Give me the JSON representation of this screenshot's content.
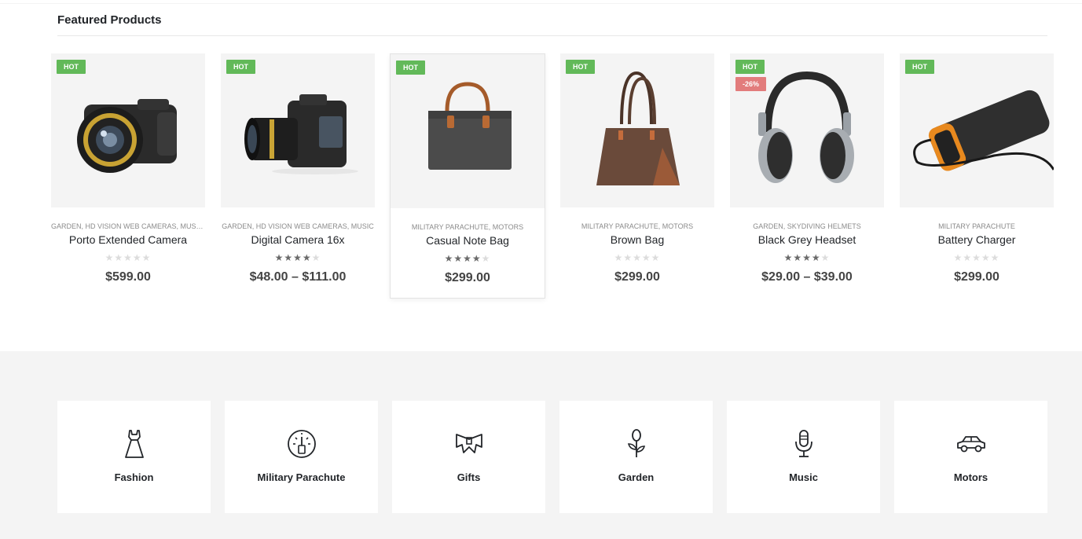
{
  "section": {
    "title": "Featured Products"
  },
  "products": [
    {
      "badge": "HOT",
      "sale": "",
      "categories": "GARDEN, HD VISION WEB CAMERAS, MUSIC...",
      "name": "Porto Extended Camera",
      "rating": 0,
      "price": "$599.00",
      "image_icon": "camera-lens-icon"
    },
    {
      "badge": "HOT",
      "sale": "",
      "categories": "GARDEN, HD VISION WEB CAMERAS, MUSIC",
      "name": "Digital Camera 16x",
      "rating": 4,
      "price": "$48.00 – $111.00",
      "image_icon": "dslr-camera-icon"
    },
    {
      "badge": "HOT",
      "sale": "",
      "categories": "MILITARY PARACHUTE, MOTORS",
      "name": "Casual Note Bag",
      "rating": 4,
      "price": "$299.00",
      "image_icon": "note-bag-icon"
    },
    {
      "badge": "HOT",
      "sale": "",
      "categories": "MILITARY PARACHUTE, MOTORS",
      "name": "Brown Bag",
      "rating": 0,
      "price": "$299.00",
      "image_icon": "tote-bag-icon"
    },
    {
      "badge": "HOT",
      "sale": "-26%",
      "categories": "GARDEN, SKYDIVING HELMETS",
      "name": "Black Grey Headset",
      "rating": 4,
      "price": "$29.00 – $39.00",
      "image_icon": "headphones-icon"
    },
    {
      "badge": "HOT",
      "sale": "",
      "categories": "MILITARY PARACHUTE",
      "name": "Battery Charger",
      "rating": 0,
      "price": "$299.00",
      "image_icon": "power-bank-icon"
    }
  ],
  "categories": [
    {
      "label": "Fashion",
      "icon": "dress-icon"
    },
    {
      "label": "Military Parachute",
      "icon": "gauge-icon"
    },
    {
      "label": "Gifts",
      "icon": "bow-icon"
    },
    {
      "label": "Garden",
      "icon": "flower-icon"
    },
    {
      "label": "Music",
      "icon": "microphone-icon"
    },
    {
      "label": "Motors",
      "icon": "car-icon"
    }
  ],
  "colors": {
    "hot_badge": "#62b959",
    "sale_badge": "#e27c7c",
    "band_bg": "#f4f4f4"
  }
}
